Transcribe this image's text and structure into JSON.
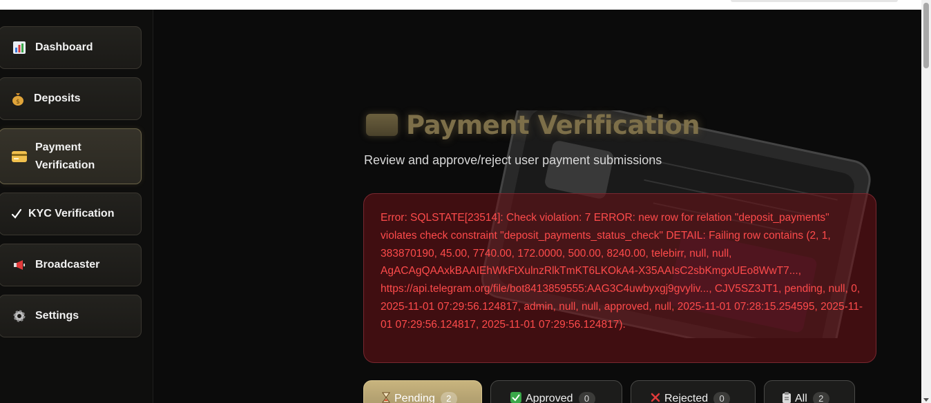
{
  "sidebar": {
    "items": [
      {
        "label": "Dashboard",
        "icon": "bar-chart-icon",
        "active": false
      },
      {
        "label": "Deposits",
        "icon": "money-bag-icon",
        "active": false
      },
      {
        "label": "Payment Verification",
        "icon": "credit-card-icon",
        "active": true
      },
      {
        "label": "KYC Verification",
        "icon": "check-mark-icon",
        "active": false
      },
      {
        "label": "Broadcaster",
        "icon": "megaphone-icon",
        "active": false
      },
      {
        "label": "Settings",
        "icon": "gear-icon",
        "active": false
      }
    ]
  },
  "main": {
    "title": "Payment Verification",
    "title_icon": "credit-card-icon",
    "subtitle": "Review and approve/reject user payment submissions",
    "error": "Error: SQLSTATE[23514]: Check violation: 7 ERROR: new row for relation \"deposit_payments\" violates check constraint \"deposit_payments_status_check\" DETAIL: Failing row contains (2, 1, 383870190, 45.00, 7740.00, 172.0000, 500.00, 8240.00, telebirr, null, null, AgACAgQAAxkBAAIEhWkFtXulnzRlkTmKT6LKOkA4-X35AAIsC2sbKmgxUEo8WwT7..., https://api.telegram.org/file/bot8413859555:AAG3C4uwbyxgj9gvyliv..., CJV5SZ3JT1, pending, null, 0, 2025-11-01 07:29:56.124817, admin, null, null, approved, null, 2025-11-01 07:28:15.254595, 2025-11-01 07:29:56.124817, 2025-11-01 07:29:56.124817).",
    "tabs": [
      {
        "label": "Pending",
        "count": "2",
        "icon": "hourglass-icon",
        "active": true
      },
      {
        "label": "Approved",
        "count": "0",
        "icon": "check-box-icon",
        "active": false
      },
      {
        "label": "Rejected",
        "count": "0",
        "icon": "cross-icon",
        "active": false
      },
      {
        "label": "All",
        "count": "2",
        "icon": "clipboard-icon",
        "active": false
      }
    ]
  },
  "colors": {
    "accent_gold": "#7d6f49",
    "error_red": "#ff4b4b",
    "background": "#0b0b0b"
  }
}
